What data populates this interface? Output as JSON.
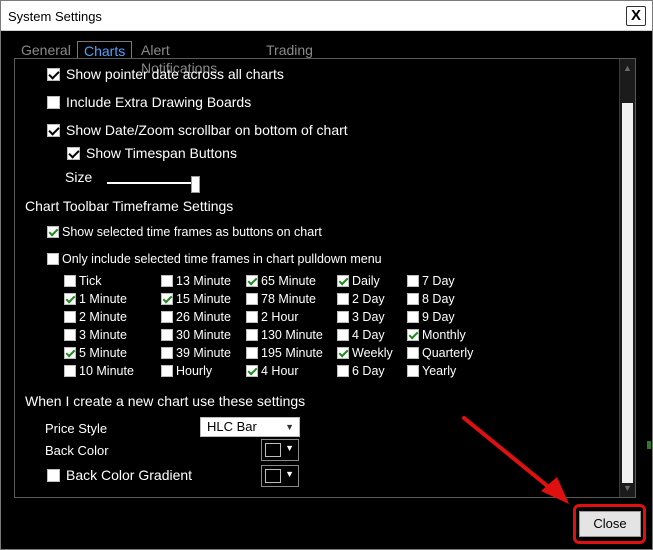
{
  "window": {
    "title": "System Settings",
    "close_x": "X"
  },
  "tabs": [
    {
      "label": "General"
    },
    {
      "label": "Charts"
    },
    {
      "label": "Alert Notifications"
    },
    {
      "label": "Trading"
    }
  ],
  "options": {
    "show_pointer_date": {
      "label": "Show pointer date across all charts",
      "checked": true
    },
    "extra_drawing_boards": {
      "label": "Include Extra Drawing Boards",
      "checked": false
    },
    "date_zoom_scrollbar": {
      "label": "Show Date/Zoom scrollbar on bottom of chart",
      "checked": true
    },
    "timespan_buttons": {
      "label": "Show Timespan Buttons",
      "checked": true
    },
    "size_label": "Size",
    "size_level": 0.95
  },
  "toolbar_section": {
    "heading": "Chart Toolbar Timeframe Settings",
    "show_as_buttons": {
      "label": "Show selected time frames as buttons on chart",
      "checked": true
    },
    "only_pulldown": {
      "label": "Only include selected time frames in chart pulldown menu",
      "checked": false
    }
  },
  "timeframes": [
    [
      {
        "label": "Tick",
        "checked": false
      },
      {
        "label": "1 Minute",
        "checked": true
      },
      {
        "label": "2 Minute",
        "checked": false
      },
      {
        "label": "3 Minute",
        "checked": false
      },
      {
        "label": "5 Minute",
        "checked": true
      },
      {
        "label": "10 Minute",
        "checked": false
      }
    ],
    [
      {
        "label": "13 Minute",
        "checked": false
      },
      {
        "label": "15 Minute",
        "checked": true
      },
      {
        "label": "26 Minute",
        "checked": false
      },
      {
        "label": "30 Minute",
        "checked": false
      },
      {
        "label": "39 Minute",
        "checked": false
      },
      {
        "label": "Hourly",
        "checked": false
      }
    ],
    [
      {
        "label": "65 Minute",
        "checked": true
      },
      {
        "label": "78 Minute",
        "checked": false
      },
      {
        "label": "2 Hour",
        "checked": false
      },
      {
        "label": "130 Minute",
        "checked": false
      },
      {
        "label": "195 Minute",
        "checked": false
      },
      {
        "label": "4 Hour",
        "checked": true
      }
    ],
    [
      {
        "label": "Daily",
        "checked": true
      },
      {
        "label": "2 Day",
        "checked": false
      },
      {
        "label": "3 Day",
        "checked": false
      },
      {
        "label": "4 Day",
        "checked": false
      },
      {
        "label": "Weekly",
        "checked": true
      },
      {
        "label": "6 Day",
        "checked": false
      }
    ],
    [
      {
        "label": "7 Day",
        "checked": false
      },
      {
        "label": "8 Day",
        "checked": false
      },
      {
        "label": "9 Day",
        "checked": false
      },
      {
        "label": "Monthly",
        "checked": true
      },
      {
        "label": "Quarterly",
        "checked": false
      },
      {
        "label": "Yearly",
        "checked": false
      }
    ]
  ],
  "new_chart_section": {
    "heading": "When I create a new chart use these settings",
    "price_style_label": "Price Style",
    "price_style_value": "HLC Bar",
    "back_color_label": "Back Color",
    "back_color_gradient": {
      "label": "Back Color Gradient",
      "checked": false
    }
  },
  "footer": {
    "close_label": "Close"
  },
  "colors": {
    "background": "#000000",
    "active_tab": "#4da3ff",
    "highlight": "#e01010",
    "check_green": "#1e8a1e"
  }
}
